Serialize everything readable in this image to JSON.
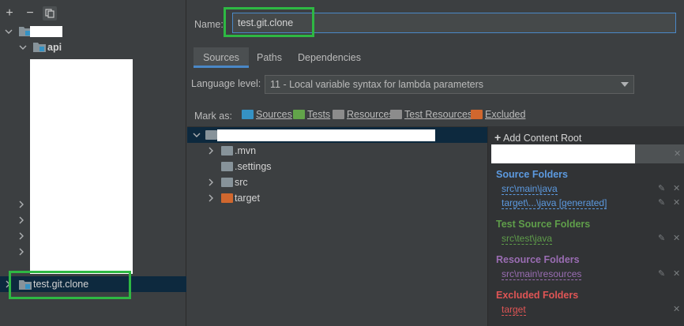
{
  "left_panel": {
    "toolbar": {
      "add": "+",
      "remove": "−",
      "copy": "⧉"
    },
    "tree": {
      "api_label": "api",
      "selected_label": "test.git.clone"
    }
  },
  "right_panel": {
    "name_label": "Name:",
    "name_value": "test.git.clone",
    "tabs": [
      "Sources",
      "Paths",
      "Dependencies"
    ],
    "language_level_label": "Language level:",
    "language_level_value": "11 - Local variable syntax for lambda parameters",
    "mark_as_label": "Mark as:",
    "mark_as": [
      {
        "label": "Sources",
        "color": "#3592c4"
      },
      {
        "label": "Tests",
        "color": "#62a44a"
      },
      {
        "label": "Resources",
        "color": "#8c8c8c"
      },
      {
        "label": "Test Resources",
        "color": "#8c8c8c"
      },
      {
        "label": "Excluded",
        "color": "#d0672e"
      }
    ],
    "content_tree": [
      {
        "label": ".mvn",
        "color": "#87939a"
      },
      {
        "label": ".settings",
        "color": "#87939a"
      },
      {
        "label": "src",
        "color": "#87939a"
      },
      {
        "label": "target",
        "color": "#d0672e"
      }
    ],
    "content_roots": {
      "add_label": "Add Content Root",
      "sections": [
        {
          "title": "Source Folders",
          "color": "#5c9ae0",
          "paths": [
            "src\\main\\java",
            "target\\...\\java [generated]"
          ]
        },
        {
          "title": "Test Source Folders",
          "color": "#5f9e4a",
          "paths": [
            "src\\test\\java"
          ]
        },
        {
          "title": "Resource Folders",
          "color": "#9a6db3",
          "paths": [
            "src\\main\\resources"
          ]
        },
        {
          "title": "Excluded Folders",
          "color": "#e05555",
          "paths": [
            "target"
          ]
        }
      ]
    }
  },
  "colors": {
    "highlight": "#2eb843",
    "selection": "#0d293e",
    "accent": "#4a88c7"
  }
}
